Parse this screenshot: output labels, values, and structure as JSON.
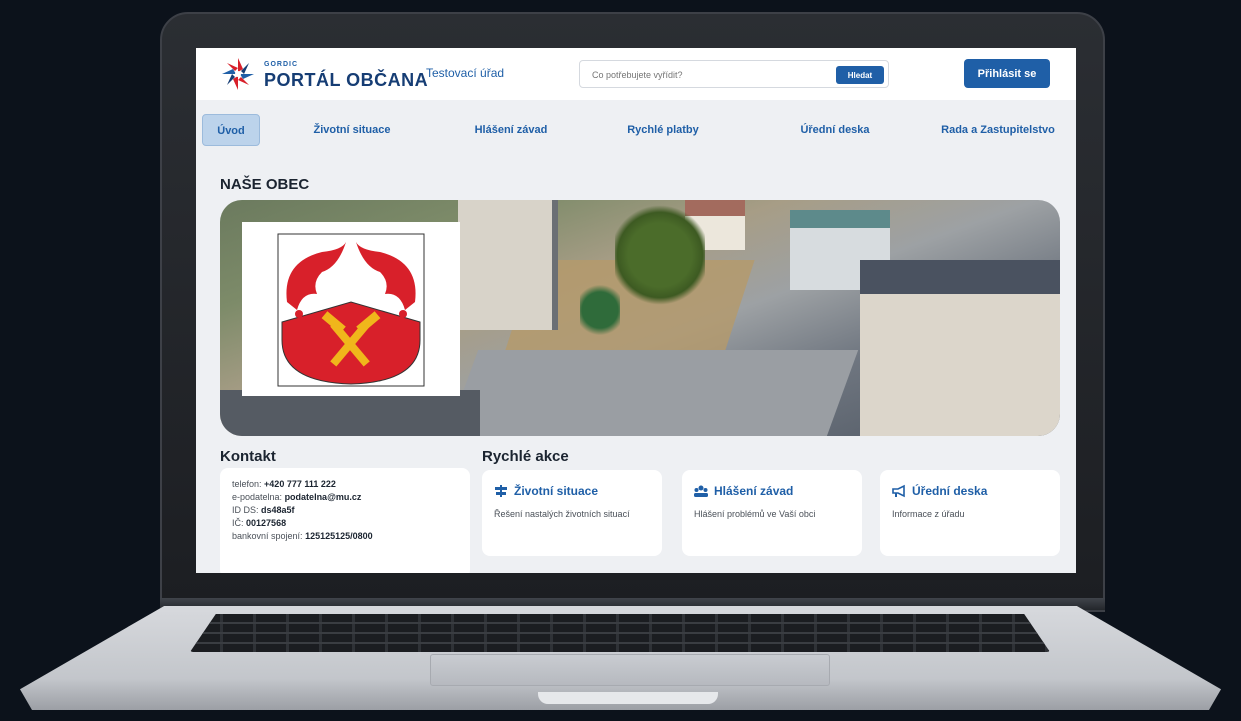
{
  "header": {
    "brand_small": "GORDIC",
    "brand": "PORTÁL OBČANA",
    "office": "Testovací úřad",
    "search_placeholder": "Co potřebujete vyřídit?",
    "search_button": "Hledat",
    "login_button": "Přihlásit se"
  },
  "nav": {
    "items": [
      {
        "label": "Úvod"
      },
      {
        "label": "Životní situace"
      },
      {
        "label": "Hlášení závad"
      },
      {
        "label": "Rychlé platby"
      },
      {
        "label": "Úřední deska"
      },
      {
        "label": "Rada a Zastupitelstvo"
      }
    ]
  },
  "main": {
    "title": "NAŠE OBEC"
  },
  "contact": {
    "heading": "Kontakt",
    "phone_label": "telefon:",
    "phone": "+420 777 111 222",
    "email_label": "e-podatelna:",
    "email": "podatelna@mu.cz",
    "ds_label": "ID DS:",
    "ds": "ds48a5f",
    "ic_label": "IČ:",
    "ic": "00127568",
    "bank_label": "bankovní spojení:",
    "bank": "125125125/0800"
  },
  "quick_actions": {
    "heading": "Rychlé akce",
    "cards": [
      {
        "title": "Životní situace",
        "desc": "Řešení nastalých životních situací",
        "icon": "signpost-icon"
      },
      {
        "title": "Hlášení závad",
        "desc": "Hlášení problémů ve Vaší obci",
        "icon": "people-icon"
      },
      {
        "title": "Úřední deska",
        "desc": "Informace z úřadu",
        "icon": "megaphone-icon"
      }
    ]
  },
  "colors": {
    "brand_blue": "#1f5fa7",
    "brand_dark": "#163d74",
    "crest_red": "#d8202a",
    "crest_gold": "#f0b61b"
  }
}
